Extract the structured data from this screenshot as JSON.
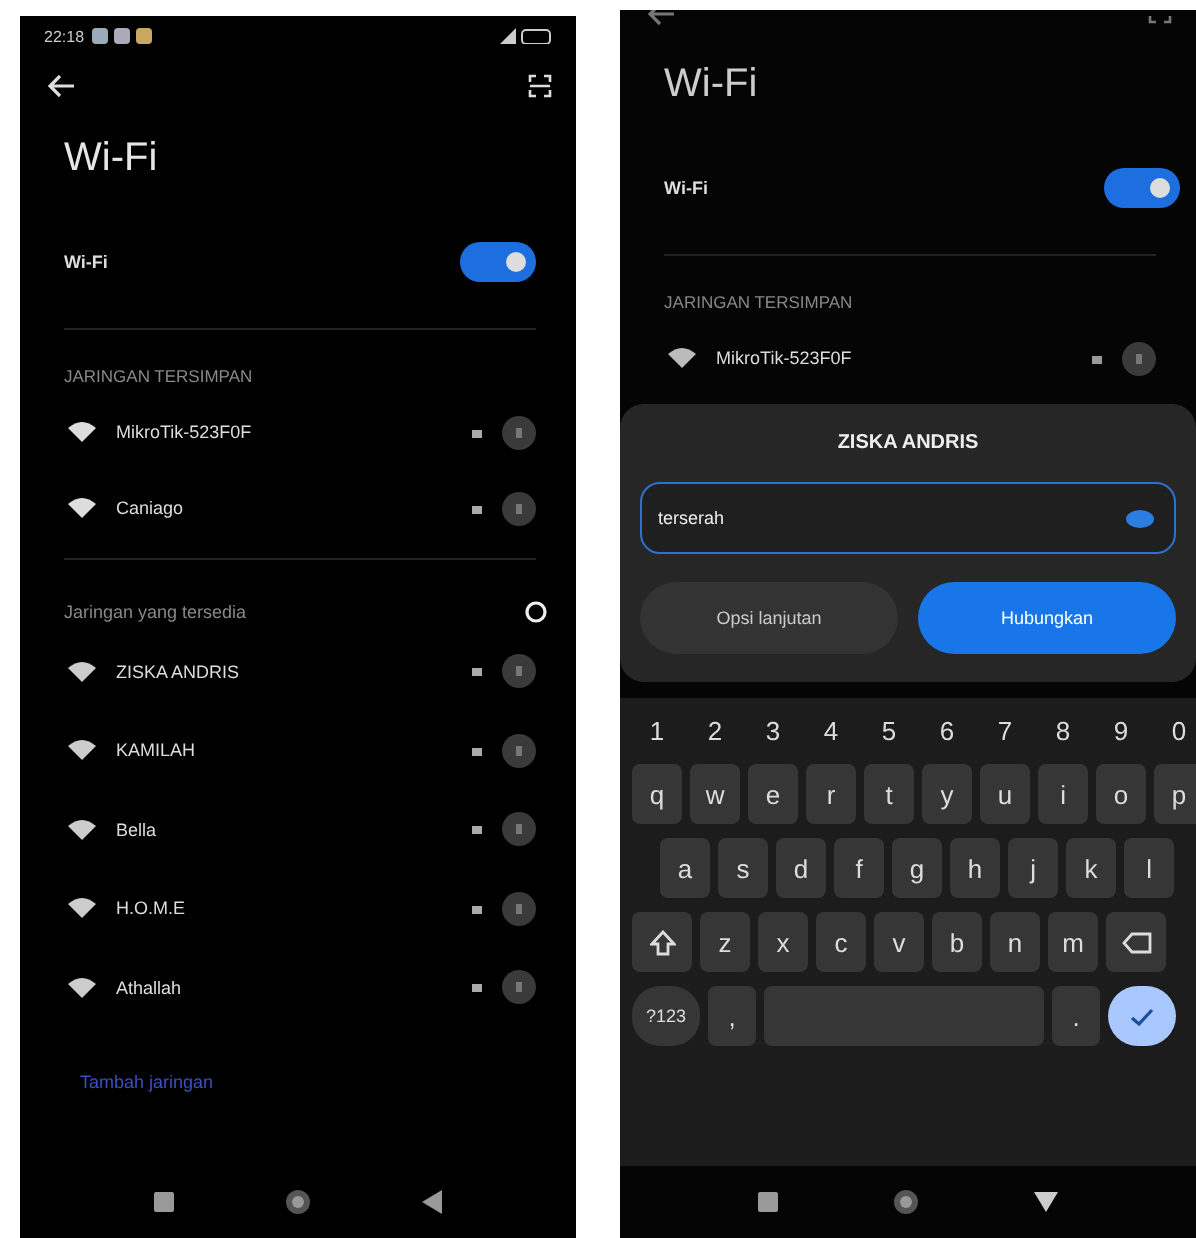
{
  "settings_screen": {
    "status_bar": {
      "time": "22:18"
    },
    "title": "Wi-Fi",
    "wifi_toggle": {
      "label": "Wi-Fi",
      "on": true
    },
    "saved_section": {
      "heading": "JARINGAN TERSIMPAN",
      "networks": [
        {
          "name": "MikroTik-523F0F"
        },
        {
          "name": "Caniago"
        }
      ]
    },
    "available_section": {
      "heading": "Jaringan yang tersedia",
      "networks": [
        {
          "name": "ZISKA ANDRIS"
        },
        {
          "name": "KAMILAH"
        },
        {
          "name": "Bella"
        },
        {
          "name": "H.O.M.E"
        },
        {
          "name": "Athallah"
        }
      ]
    },
    "add_network": "Tambah jaringan"
  },
  "password_screen": {
    "title": "Wi-Fi",
    "wifi_toggle": {
      "label": "Wi-Fi",
      "on": true
    },
    "saved_section": {
      "heading": "JARINGAN TERSIMPAN",
      "networks": [
        {
          "name": "MikroTik-523F0F"
        }
      ]
    },
    "dialog": {
      "title": "ZISKA ANDRIS",
      "password": {
        "value": "terserah"
      },
      "buttons": [
        {
          "label": "Opsi lanjutan",
          "kind": "secondary"
        },
        {
          "label": "Hubungkan",
          "kind": "primary"
        }
      ]
    },
    "keyboard": {
      "rows": [
        [
          {
            "kind": "digit",
            "label": "1"
          },
          {
            "kind": "digit",
            "label": "2"
          },
          {
            "kind": "digit",
            "label": "3"
          },
          {
            "kind": "digit",
            "label": "4"
          },
          {
            "kind": "digit",
            "label": "5"
          },
          {
            "kind": "digit",
            "label": "6"
          },
          {
            "kind": "digit",
            "label": "7"
          },
          {
            "kind": "digit",
            "label": "8"
          },
          {
            "kind": "digit",
            "label": "9"
          },
          {
            "kind": "digit",
            "label": "0"
          }
        ],
        [
          {
            "kind": "letter",
            "label": "q"
          },
          {
            "kind": "letter",
            "label": "w"
          },
          {
            "kind": "letter",
            "label": "e"
          },
          {
            "kind": "letter",
            "label": "r"
          },
          {
            "kind": "letter",
            "label": "t"
          },
          {
            "kind": "letter",
            "label": "y"
          },
          {
            "kind": "letter",
            "label": "u"
          },
          {
            "kind": "letter",
            "label": "i"
          },
          {
            "kind": "letter",
            "label": "o"
          },
          {
            "kind": "letter",
            "label": "p"
          }
        ],
        [
          {
            "kind": "letter",
            "label": "a"
          },
          {
            "kind": "letter",
            "label": "s"
          },
          {
            "kind": "letter",
            "label": "d"
          },
          {
            "kind": "letter",
            "label": "f"
          },
          {
            "kind": "letter",
            "label": "g"
          },
          {
            "kind": "letter",
            "label": "h"
          },
          {
            "kind": "letter",
            "label": "j"
          },
          {
            "kind": "letter",
            "label": "k"
          },
          {
            "kind": "letter",
            "label": "l"
          }
        ],
        [
          {
            "kind": "shift"
          },
          {
            "kind": "letter",
            "label": "z"
          },
          {
            "kind": "letter",
            "label": "x"
          },
          {
            "kind": "letter",
            "label": "c"
          },
          {
            "kind": "letter",
            "label": "v"
          },
          {
            "kind": "letter",
            "label": "b"
          },
          {
            "kind": "letter",
            "label": "n"
          },
          {
            "kind": "letter",
            "label": "m"
          },
          {
            "kind": "backspace"
          }
        ],
        [
          {
            "kind": "symbols",
            "label": "?123"
          },
          {
            "kind": "punct",
            "label": ","
          },
          {
            "kind": "space"
          },
          {
            "kind": "punct",
            "label": "."
          },
          {
            "kind": "enter"
          }
        ]
      ]
    }
  }
}
